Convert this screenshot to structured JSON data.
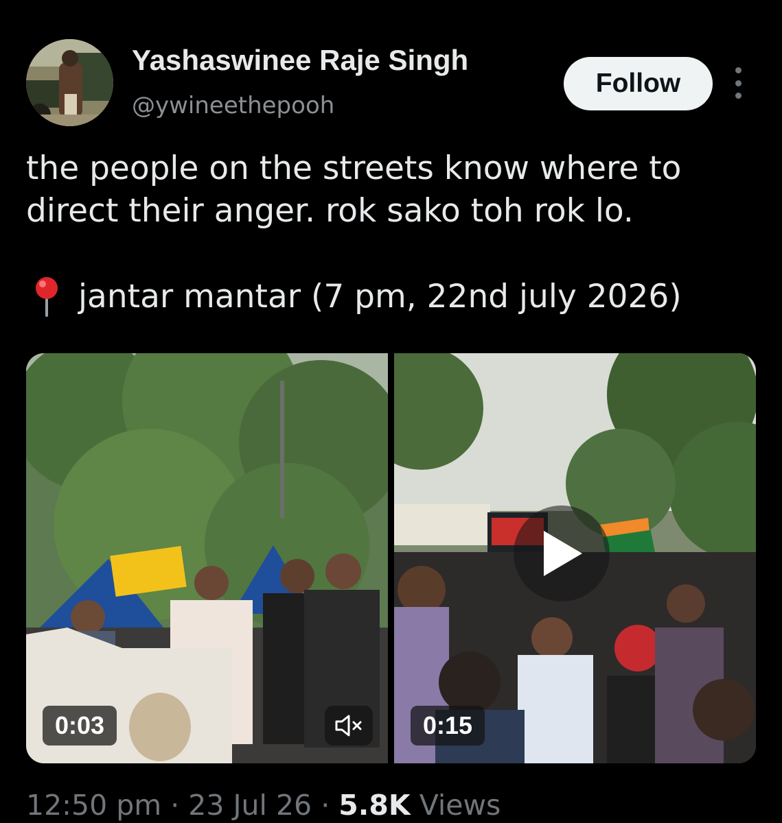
{
  "author": {
    "name": "Yashaswinee Raje Singh",
    "handle": "@ywineethepooh"
  },
  "actions": {
    "follow_label": "Follow"
  },
  "tweet": {
    "line1": "the people on the streets know where to",
    "line2": "direct their anger. rok sako toh rok lo.",
    "location_icon": "round-pushpin",
    "location_text": "jantar mantar (7 pm, 22nd july 2026)"
  },
  "media": [
    {
      "duration": "0:03",
      "muted_icon": "speaker-muted-icon"
    },
    {
      "duration": "0:15",
      "play_icon": "play-icon"
    }
  ],
  "meta": {
    "time": "12:50 pm",
    "sep1": " · ",
    "date": "23 Jul 26",
    "sep2": " · ",
    "views_count": "5.8K",
    "views_label": " Views"
  },
  "colors": {
    "background": "#000000",
    "text_primary": "#e7e9ea",
    "text_secondary": "#71767b",
    "follow_bg": "#eff3f4",
    "follow_text": "#0f1419"
  }
}
